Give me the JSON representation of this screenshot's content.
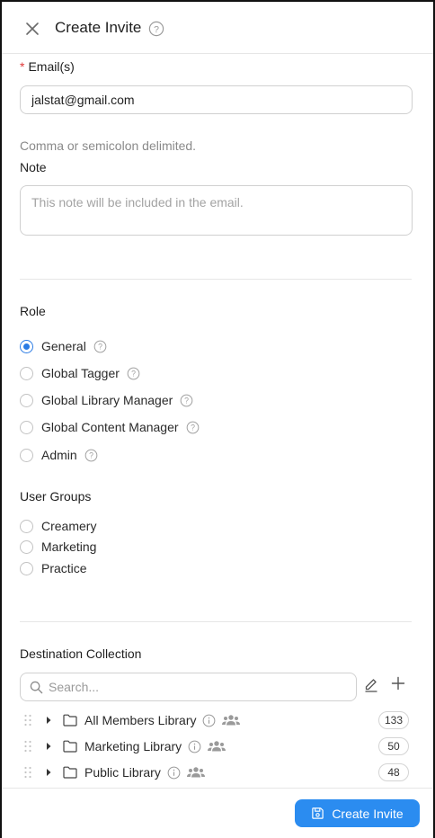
{
  "header": {
    "title": "Create Invite"
  },
  "email": {
    "required_mark": "*",
    "label": "Email(s)",
    "value": "jalstat@gmail.com",
    "hint": "Comma or semicolon delimited."
  },
  "note": {
    "label": "Note",
    "placeholder": "This note will be included in the email."
  },
  "role": {
    "label": "Role",
    "options": [
      {
        "label": "General",
        "checked": true
      },
      {
        "label": "Global Tagger",
        "checked": false
      },
      {
        "label": "Global Library Manager",
        "checked": false
      },
      {
        "label": "Global Content Manager",
        "checked": false
      },
      {
        "label": "Admin",
        "checked": false
      }
    ]
  },
  "user_groups": {
    "label": "User Groups",
    "options": [
      {
        "label": "Creamery"
      },
      {
        "label": "Marketing"
      },
      {
        "label": "Practice"
      }
    ]
  },
  "destination": {
    "label": "Destination Collection",
    "search_placeholder": "Search...",
    "collections": [
      {
        "name": "All Members Library",
        "count": "133"
      },
      {
        "name": "Marketing Library",
        "count": "50"
      },
      {
        "name": "Public Library",
        "count": "48"
      }
    ]
  },
  "footer": {
    "submit_label": "Create Invite"
  },
  "colors": {
    "accent": "#2b8cf0",
    "required": "#e03a3a"
  }
}
